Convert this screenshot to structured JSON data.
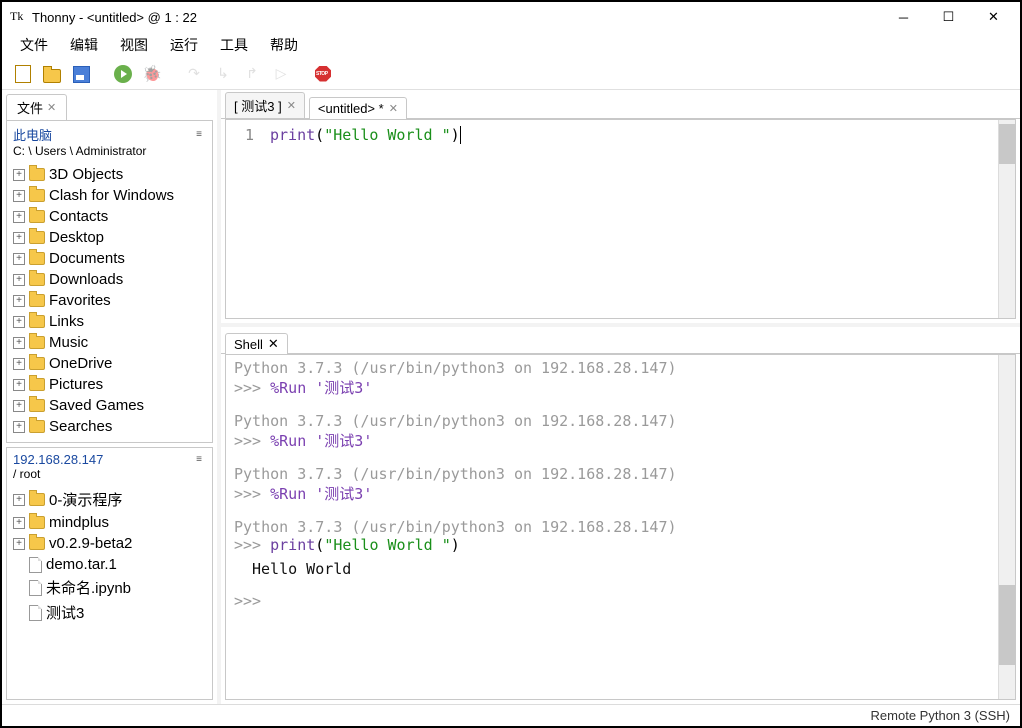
{
  "window": {
    "title": "Thonny  -  <untitled>  @  1 : 22"
  },
  "menu": {
    "items": [
      "文件",
      "编辑",
      "视图",
      "运行",
      "工具",
      "帮助"
    ]
  },
  "sidebar": {
    "files_tab": "文件",
    "local": {
      "title": "此电脑",
      "path": "C: \\ Users \\ Administrator",
      "items": [
        {
          "label": "3D Objects",
          "type": "folder",
          "exp": true
        },
        {
          "label": "Clash for Windows",
          "type": "folder",
          "exp": true
        },
        {
          "label": "Contacts",
          "type": "folder",
          "exp": true
        },
        {
          "label": "Desktop",
          "type": "folder",
          "exp": true
        },
        {
          "label": "Documents",
          "type": "folder",
          "exp": true
        },
        {
          "label": "Downloads",
          "type": "folder",
          "exp": true
        },
        {
          "label": "Favorites",
          "type": "folder",
          "exp": true
        },
        {
          "label": "Links",
          "type": "folder",
          "exp": true
        },
        {
          "label": "Music",
          "type": "folder",
          "exp": true
        },
        {
          "label": "OneDrive",
          "type": "folder",
          "exp": true
        },
        {
          "label": "Pictures",
          "type": "folder",
          "exp": true
        },
        {
          "label": "Saved Games",
          "type": "folder",
          "exp": true
        },
        {
          "label": "Searches",
          "type": "folder",
          "exp": true
        }
      ]
    },
    "remote": {
      "title": "192.168.28.147",
      "path": "/ root",
      "items": [
        {
          "label": "0-演示程序",
          "type": "folder",
          "exp": true
        },
        {
          "label": "mindplus",
          "type": "folder",
          "exp": true
        },
        {
          "label": "v0.2.9-beta2",
          "type": "folder",
          "exp": true
        },
        {
          "label": "demo.tar.1",
          "type": "file",
          "exp": false
        },
        {
          "label": "未命名.ipynb",
          "type": "file",
          "exp": false
        },
        {
          "label": "测试3",
          "type": "file",
          "exp": false
        }
      ]
    }
  },
  "editor": {
    "tabs": [
      {
        "label": "[ 测试3 ]",
        "active": false
      },
      {
        "label": "<untitled> *",
        "active": true
      }
    ],
    "gutter": [
      "1"
    ],
    "code": {
      "fn": "print",
      "open": "(",
      "str": "\"Hello World \"",
      "close": ")"
    }
  },
  "shell": {
    "tab": "Shell",
    "entries": [
      {
        "info": "Python 3.7.3 (/usr/bin/python3 on 192.168.28.147)",
        "prompt": ">>>",
        "cmd_type": "magic",
        "cmd": "%Run '测试3'"
      },
      {
        "info": "Python 3.7.3 (/usr/bin/python3 on 192.168.28.147)",
        "prompt": ">>>",
        "cmd_type": "magic",
        "cmd": "%Run '测试3'"
      },
      {
        "info": "Python 3.7.3 (/usr/bin/python3 on 192.168.28.147)",
        "prompt": ">>>",
        "cmd_type": "magic",
        "cmd": "%Run '测试3'"
      },
      {
        "info": "Python 3.7.3 (/usr/bin/python3 on 192.168.28.147)",
        "prompt": ">>>",
        "cmd_type": "print",
        "fn": "print",
        "open": "(",
        "str": "\"Hello World \"",
        "close": ")",
        "out": "Hello World "
      }
    ],
    "final_prompt": ">>>"
  },
  "status": {
    "text": "Remote Python 3 (SSH)"
  }
}
